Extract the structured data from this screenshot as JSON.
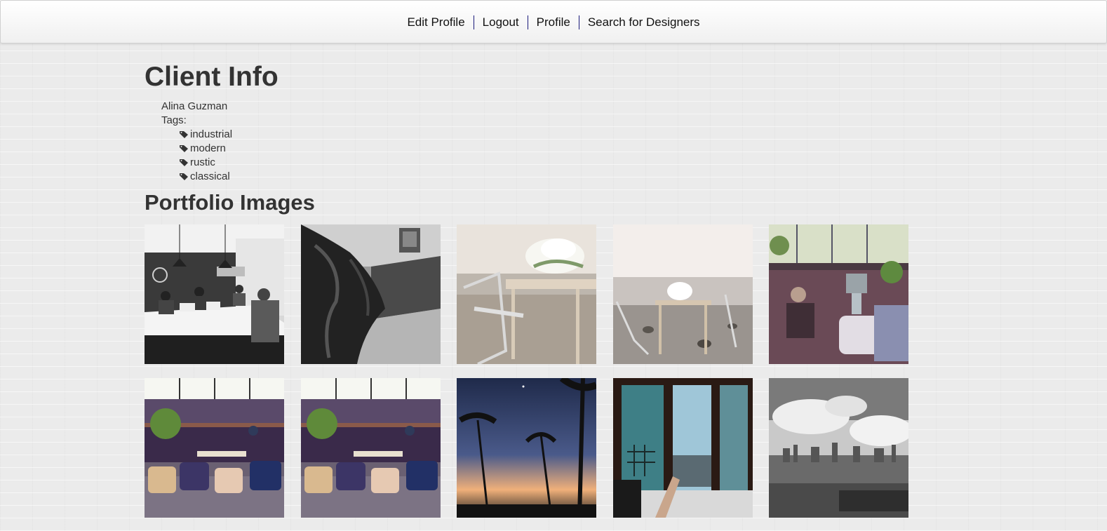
{
  "nav": {
    "items": [
      {
        "label": "Edit Profile"
      },
      {
        "label": "Logout"
      },
      {
        "label": "Profile"
      },
      {
        "label": "Search for Designers"
      }
    ]
  },
  "client": {
    "heading": "Client Info",
    "name": "Alina Guzman",
    "tags_label": "Tags:",
    "tags": [
      "industrial",
      "modern",
      "rustic",
      "classical"
    ]
  },
  "portfolio": {
    "heading": "Portfolio Images",
    "images": [
      {
        "subject": "office-meeting-bw"
      },
      {
        "subject": "plant-billiard-bw"
      },
      {
        "subject": "beach-table-flowers"
      },
      {
        "subject": "shoreline-table-flowers"
      },
      {
        "subject": "lounge-woman-lamp"
      },
      {
        "subject": "sofa-skylight"
      },
      {
        "subject": "sofa-skylight"
      },
      {
        "subject": "palm-sunset"
      },
      {
        "subject": "window-view-feet"
      },
      {
        "subject": "city-skyline-bw"
      }
    ]
  },
  "colors": {
    "nav_separator": "#1a1a7a",
    "text": "#333333",
    "background": "#ebebeb"
  }
}
